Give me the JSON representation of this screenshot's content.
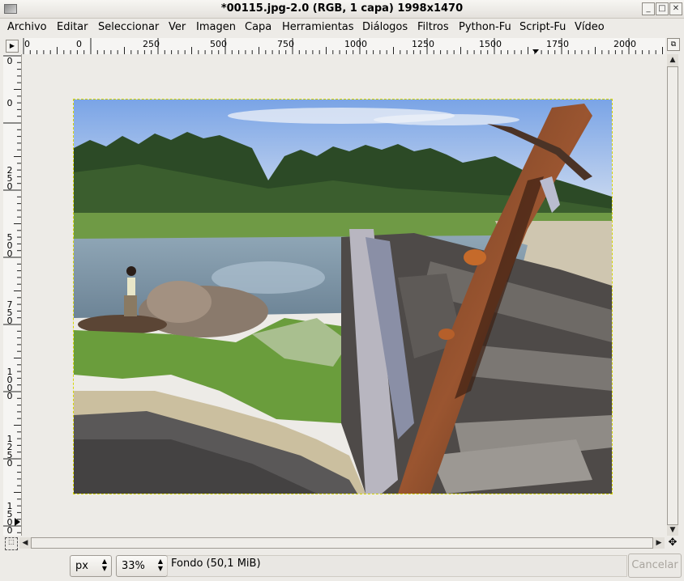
{
  "window": {
    "title": "*00115.jpg-2.0 (RGB, 1 capa) 1998x1470",
    "minimize": "_",
    "maximize": "□",
    "close": "✕"
  },
  "menu": [
    "Archivo",
    "Editar",
    "Seleccionar",
    "Ver",
    "Imagen",
    "Capa",
    "Herramientas",
    "Diálogos",
    "Filtros",
    "Python-Fu",
    "Script-Fu",
    "Vídeo"
  ],
  "hruler": {
    "labels": [
      "0",
      "0",
      "250",
      "500",
      "750",
      "1000",
      "1250",
      "1500",
      "1750",
      "2000"
    ]
  },
  "vruler": {
    "labels": [
      "0",
      "0",
      "250",
      "500",
      "750",
      "1000",
      "1250",
      "1500"
    ]
  },
  "statusbar": {
    "unit": "px",
    "zoom": "33%",
    "info": "Fondo (50,1 MiB)",
    "cancel": "Cancelar"
  },
  "icons": {
    "app": "gimp-image-icon",
    "menu_button": "triangle-right-icon",
    "navigate": "navigate-icon",
    "quickmask": "quickmask-icon",
    "move": "move-icon"
  },
  "colors": {
    "selection_marching_ants": "#d6d600",
    "canvas_bg": "#edebe7"
  }
}
